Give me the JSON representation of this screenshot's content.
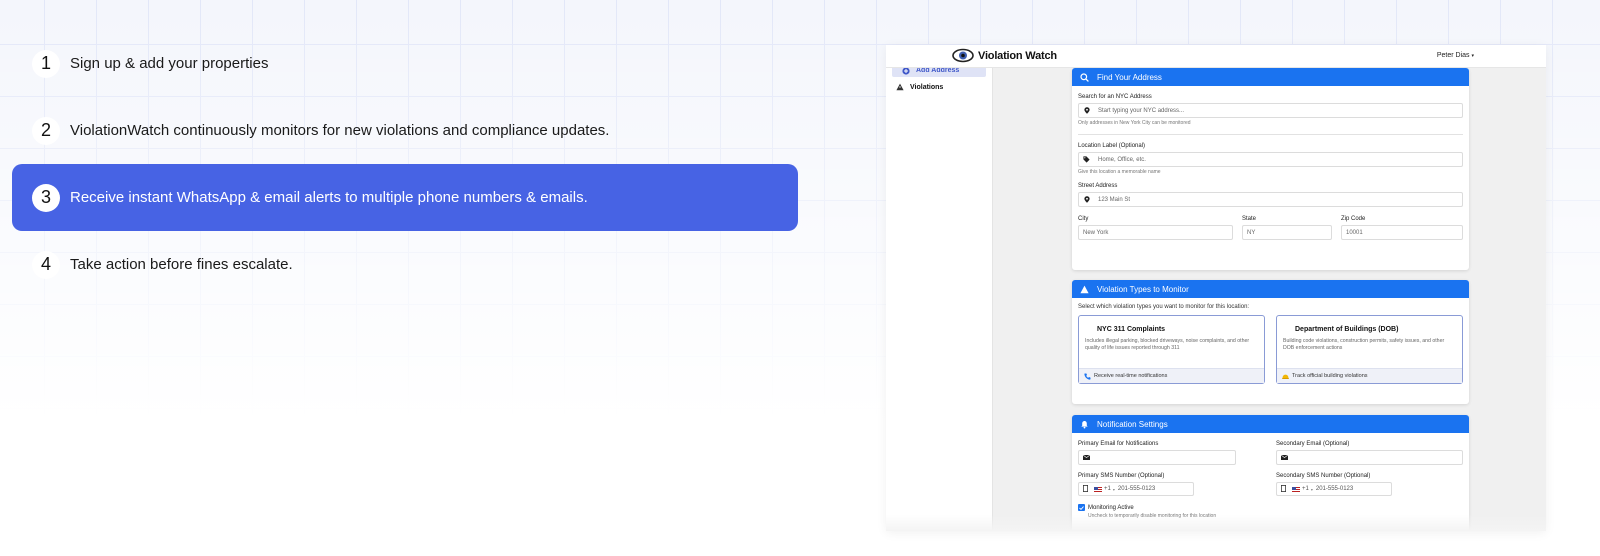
{
  "steps": [
    {
      "num": "1",
      "text": "Sign up & add your properties"
    },
    {
      "num": "2",
      "text": "ViolationWatch continuously monitors for new violations and compliance updates."
    },
    {
      "num": "3",
      "text": "Receive instant WhatsApp & email alerts to multiple phone numbers & emails."
    },
    {
      "num": "4",
      "text": "Take action before fines escalate."
    }
  ],
  "colors": {
    "active_step": "#4763e4",
    "card_header": "#1a73f0",
    "sidebar_active": "#dfe3f6"
  },
  "app": {
    "brand": "Violation Watch",
    "user": "Peter Dias",
    "user_caret": "▾",
    "sidebar": [
      {
        "label": "Add Address",
        "icon": "plus-circle-icon"
      },
      {
        "label": "Violations",
        "icon": "warning-icon"
      }
    ],
    "find_address": {
      "header": "Find Your Address",
      "search_label": "Search for an NYC Address",
      "search_placeholder": "Start typing your NYC address...",
      "search_hint": "Only addresses in New York City can be monitored",
      "location_label": "Location Label (Optional)",
      "location_placeholder": "Home, Office, etc.",
      "location_hint": "Give this location a memorable name",
      "street_label": "Street Address",
      "street_placeholder": "123 Main St",
      "city_label": "City",
      "city_placeholder": "New York",
      "state_label": "State",
      "state_placeholder": "NY",
      "zip_label": "Zip Code",
      "zip_placeholder": "10001"
    },
    "violation_types": {
      "header": "Violation Types to Monitor",
      "description": "Select which violation types you want to monitor for this location:",
      "types": [
        {
          "title": "NYC 311 Complaints",
          "text": "Includes illegal parking, blocked driveways, noise complaints, and other quality of life issues reported through 311",
          "footer": "Receive real-time notifications",
          "icon": "phone-icon"
        },
        {
          "title": "Department of Buildings (DOB)",
          "text": "Building code violations, construction permits, safety issues, and other DOB enforcement actions",
          "footer": "Track official building violations",
          "icon": "hardhat-icon"
        }
      ]
    },
    "notifications": {
      "header": "Notification Settings",
      "primary_email_label": "Primary Email for Notifications",
      "secondary_email_label": "Secondary Email (Optional)",
      "primary_sms_label": "Primary SMS Number (Optional)",
      "secondary_sms_label": "Secondary SMS Number (Optional)",
      "country_code": "+1",
      "code_caret": "▾",
      "sms_placeholder": "201-555-0123",
      "monitoring_label": "Monitoring Active",
      "monitoring_hint": "Uncheck to temporarily disable monitoring for this location"
    }
  }
}
